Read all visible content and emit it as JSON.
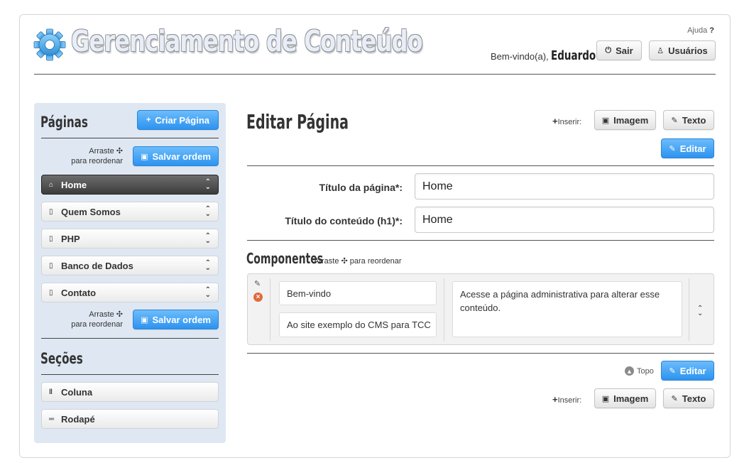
{
  "header": {
    "title": "Gerenciamento de Conteúdo",
    "help_label": "Ajuda",
    "help_mark": "?",
    "welcome_prefix": "Bem-vindo(a),",
    "user_name": "Eduardo",
    "welcome_suffix": ".",
    "logout_label": "Sair",
    "users_label": "Usuários"
  },
  "sidebar": {
    "pages_title": "Páginas",
    "create_page_label": "Criar Página",
    "drag_hint_line1": "Arraste ✣",
    "drag_hint_line2": "para reordenar",
    "save_order_label": "Salvar ordem",
    "pages": [
      {
        "label": "Home",
        "active": true
      },
      {
        "label": "Quem Somos",
        "active": false
      },
      {
        "label": "PHP",
        "active": false
      },
      {
        "label": "Banco de Dados",
        "active": false
      },
      {
        "label": "Contato",
        "active": false
      }
    ],
    "sections_title": "Seções",
    "sections": [
      {
        "label": "Coluna"
      },
      {
        "label": "Rodapé"
      }
    ]
  },
  "main": {
    "title": "Editar Página",
    "insert_label": "Inserir:",
    "insert_plus": "+",
    "image_label": "Imagem",
    "text_label": "Texto",
    "edit_label": "Editar",
    "page_title_label": "Título da página*:",
    "page_title_value": "Home",
    "content_title_label": "Título do conteúdo (h1)*:",
    "content_title_value": "Home",
    "components_title": "Componentes",
    "components_hint": "Arraste ✣ para reordenar",
    "component": {
      "field1": "Bem-vindo",
      "field2": "Ao site exemplo do CMS para TCC",
      "body": "Acesse a página administrativa para alterar esse conteúdo."
    },
    "top_label": "Topo"
  }
}
